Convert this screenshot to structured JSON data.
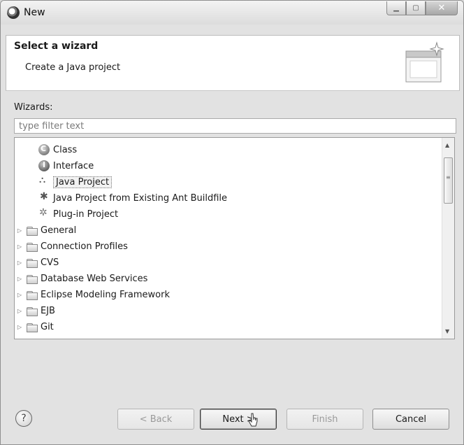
{
  "window": {
    "title": "New"
  },
  "header": {
    "title": "Select a wizard",
    "description": "Create a Java project"
  },
  "wizards": {
    "label": "Wizards:",
    "filter_placeholder": "type filter text",
    "items": [
      {
        "label": "Class",
        "icon": "class-icon",
        "level": 1,
        "expandable": false
      },
      {
        "label": "Interface",
        "icon": "interface-icon",
        "level": 1,
        "expandable": false
      },
      {
        "label": "Java Project",
        "icon": "java-project-icon",
        "level": 1,
        "expandable": false,
        "selected": true
      },
      {
        "label": "Java Project from Existing Ant Buildfile",
        "icon": "ant-project-icon",
        "level": 1,
        "expandable": false
      },
      {
        "label": "Plug-in Project",
        "icon": "plugin-project-icon",
        "level": 1,
        "expandable": false
      },
      {
        "label": "General",
        "icon": "folder-icon",
        "level": 0,
        "expandable": true
      },
      {
        "label": "Connection Profiles",
        "icon": "folder-icon",
        "level": 0,
        "expandable": true
      },
      {
        "label": "CVS",
        "icon": "folder-icon",
        "level": 0,
        "expandable": true
      },
      {
        "label": "Database Web Services",
        "icon": "folder-icon",
        "level": 0,
        "expandable": true
      },
      {
        "label": "Eclipse Modeling Framework",
        "icon": "folder-icon",
        "level": 0,
        "expandable": true
      },
      {
        "label": "EJB",
        "icon": "folder-icon",
        "level": 0,
        "expandable": true
      },
      {
        "label": "Git",
        "icon": "folder-icon",
        "level": 0,
        "expandable": true
      }
    ]
  },
  "buttons": {
    "help": "?",
    "back": "< Back",
    "next": "Next >",
    "finish": "Finish",
    "cancel": "Cancel"
  }
}
